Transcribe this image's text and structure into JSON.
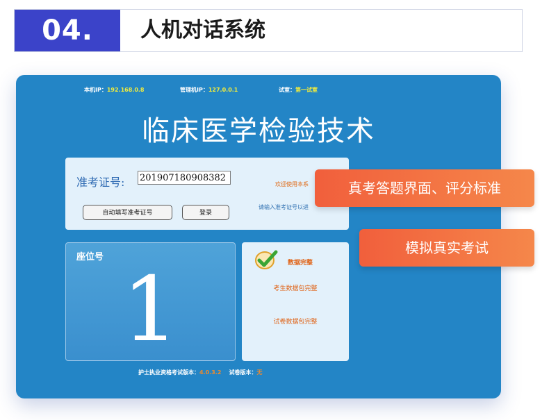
{
  "header": {
    "number": "04.",
    "title": "人机对话系统"
  },
  "screen": {
    "info": {
      "host_ip_label": "本机IP：",
      "host_ip": "192.168.0.8",
      "admin_ip_label": "管理机IP：",
      "admin_ip": "127.0.0.1",
      "room_label": "试室：",
      "room": "第一试室"
    },
    "title": "临床医学检验技术",
    "login": {
      "id_label": "准考证号:",
      "id_value": "201907180908382",
      "autofill_button": "自动填写准考证号",
      "login_button": "登录",
      "welcome": "欢迎使用本系",
      "hint": "请输入准考证号以进"
    },
    "seat": {
      "label": "座位号",
      "number": "1"
    },
    "status": {
      "icon": "check-circle-icon",
      "data_complete": "数据完整",
      "candidate_pkg": "考生数据包完整",
      "paper_pkg": "试卷数据包完整"
    },
    "footer": {
      "version_label": "护士执业资格考试版本：",
      "version": "4.0.3.2",
      "paper_label": "试卷版本：",
      "paper_version": "无"
    }
  },
  "callouts": {
    "first": "真考答题界面、评分标准",
    "second": "模拟真实考试"
  },
  "colors": {
    "banner_blue": "#3b43c9",
    "screen_blue": "#2385c6",
    "orange": "#f15f3c",
    "highlight_yellow": "#f2ec3c"
  }
}
